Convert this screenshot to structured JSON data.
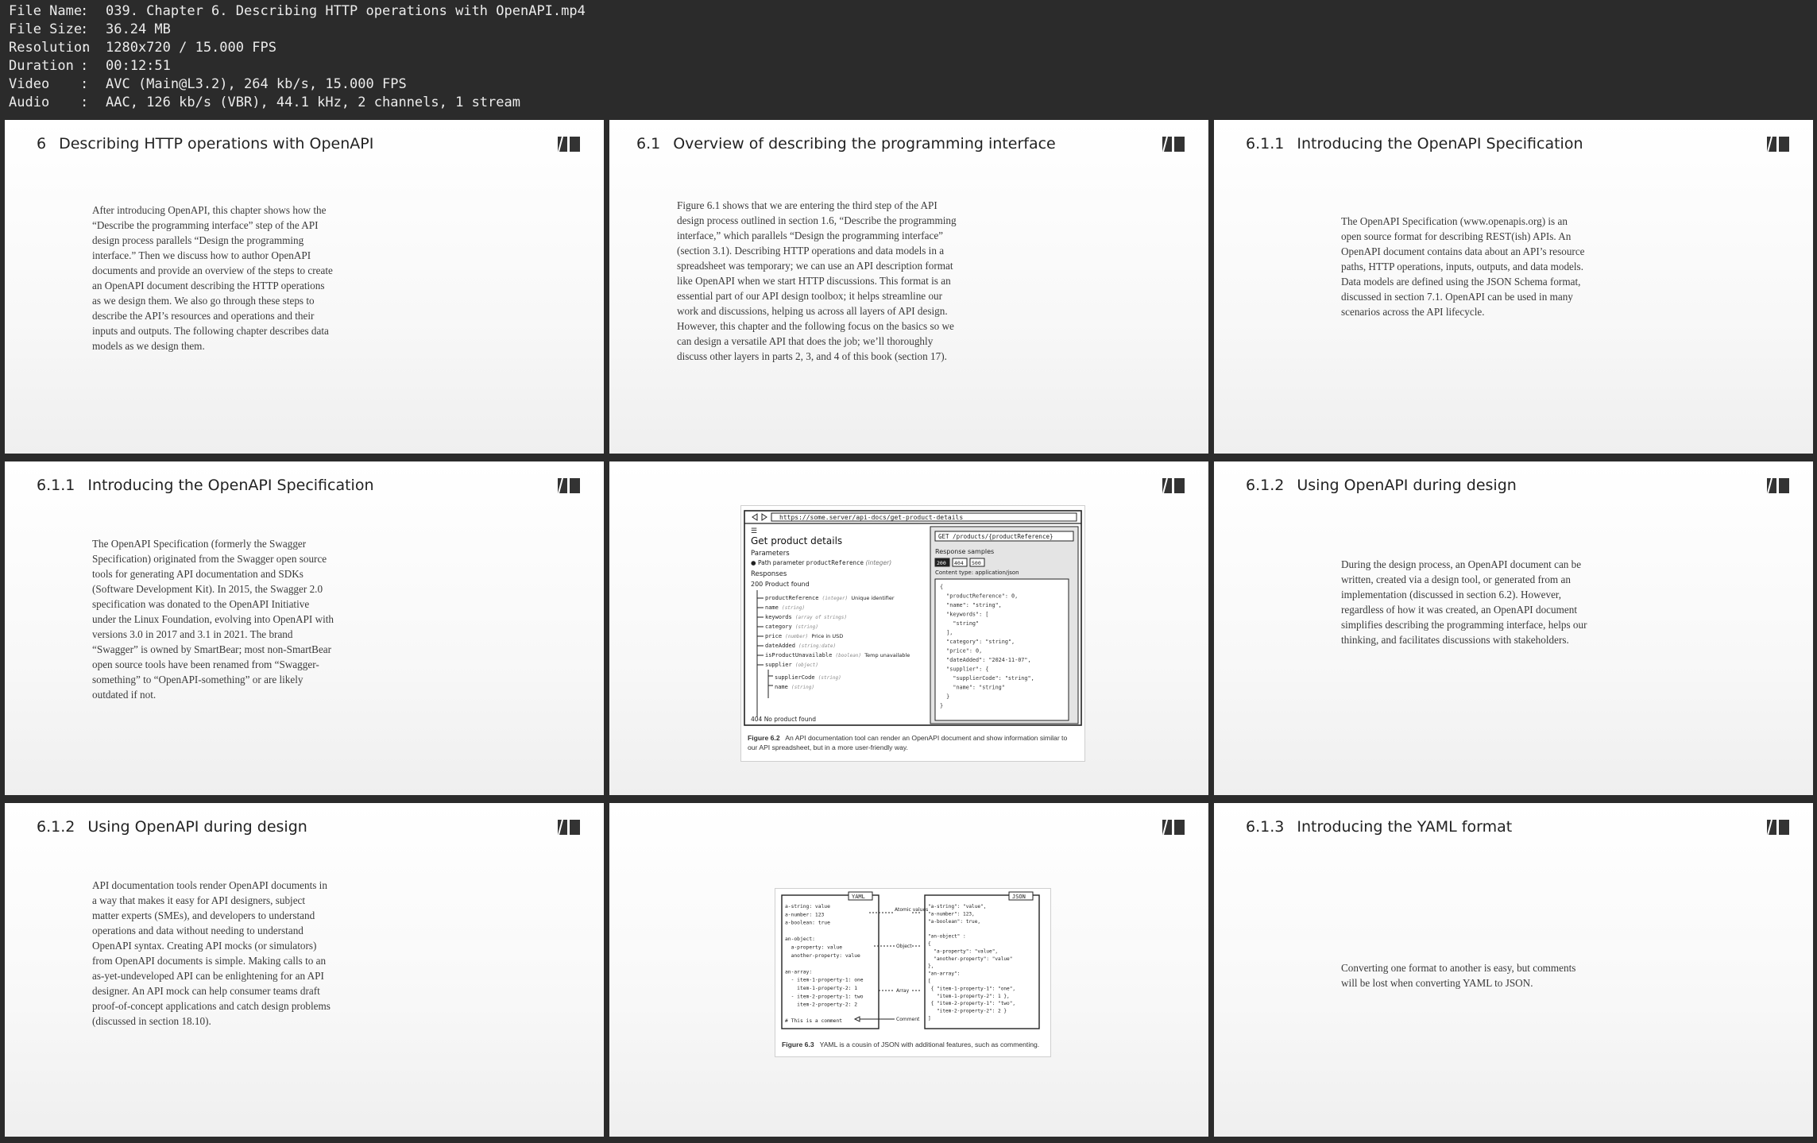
{
  "info": {
    "rows": [
      {
        "label": "File Name",
        "value": "039. Chapter 6. Describing HTTP operations with OpenAPI.mp4"
      },
      {
        "label": "File Size",
        "value": "36.24 MB"
      },
      {
        "label": "Resolution",
        "value": "1280x720 / 15.000 FPS"
      },
      {
        "label": "Duration",
        "value": "00:12:51"
      },
      {
        "label": "Video",
        "value": "AVC (Main@L3.2), 264 kb/s, 15.000 FPS"
      },
      {
        "label": "Audio",
        "value": "AAC, 126 kb/s (VBR), 44.1 kHz, 2 channels, 1 stream"
      }
    ],
    "separator": ":"
  },
  "slides": [
    {
      "num": "6",
      "title": "Describing HTTP operations with OpenAPI",
      "body": "After introducing OpenAPI, this chapter shows how the “Describe the programming interface” step of the API design process parallels “Design the programming interface.” Then we discuss how to author OpenAPI documents and provide an overview of the steps to create an OpenAPI document describing the HTTP operations as we design them. We also go through these steps to describe the API’s resources and operations and their inputs and outputs. The following chapter describes data models as we design them."
    },
    {
      "num": "6.1",
      "title": "Overview of describing the programming interface",
      "body": "Figure 6.1 shows that we are entering the third step of the API design process outlined in section 1.6, “Describe the programming interface,” which parallels “Design the programming interface” (section 3.1). Describing HTTP operations and data models in a spreadsheet was temporary; we can use an API description format like OpenAPI when we start HTTP discussions. This format is an essential part of our API design toolbox; it helps streamline our work and discussions, helping us across all layers of API design. However, this chapter and the following focus on the basics so we can design a versatile API that does the job; we’ll thoroughly discuss other layers in parts 2, 3, and 4 of this book (section 17)."
    },
    {
      "num": "6.1.1",
      "title": "Introducing the OpenAPI Specification",
      "body": "The OpenAPI Specification (www.openapis.org) is an open source format for describing REST(ish) APIs. An OpenAPI document contains data about an API’s resource paths, HTTP operations, inputs, outputs, and data models. Data models are defined using the JSON Schema format, discussed in section 7.1. OpenAPI can be used in many scenarios across the API lifecycle."
    },
    {
      "num": "6.1.1",
      "title": "Introducing the OpenAPI Specification",
      "body": "The OpenAPI Specification (formerly the Swagger Specification) originated from the Swagger open source tools for generating API documentation and SDKs (Software Development Kit). In 2015, the Swagger 2.0 specification was donated to the OpenAPI Initiative under the Linux Foundation, evolving into OpenAPI with versions 3.0 in 2017 and 3.1 in 2021. The brand “Swagger” is owned by SmartBear; most non-SmartBear open source tools have been renamed from “Swagger-something” to “OpenAPI-something” or are likely outdated if not."
    },
    {
      "num": "",
      "title": "",
      "body": ""
    },
    {
      "num": "6.1.2",
      "title": "Using OpenAPI during design",
      "body": "During the design process, an OpenAPI document can be written, created via a design tool, or generated from an implementation (discussed in section 6.2). However, regardless of how it was created, an OpenAPI document simplifies describing the programming interface, helps our thinking, and facilitates discussions with stakeholders."
    },
    {
      "num": "6.1.2",
      "title": "Using OpenAPI during design",
      "body": "API documentation tools render OpenAPI documents in a way that makes it easy for API designers, subject matter experts (SMEs), and developers to understand operations and data without needing to understand OpenAPI syntax. Creating API mocks (or simulators) from OpenAPI documents is simple. Making calls to an as-yet-undeveloped API can be enlightening for an API designer. An API mock can help consumer teams draft proof-of-concept applications and catch design problems (discussed in section 18.10)."
    },
    {
      "num": "",
      "title": "",
      "body": ""
    },
    {
      "num": "6.1.3",
      "title": "Introducing the YAML format",
      "body": "Converting one format to another is easy, but comments will be lost when converting YAML to JSON."
    }
  ],
  "figure62": {
    "url": "https://some.server/api-docs/get-product-details",
    "heading": "Get product details",
    "parameters_label": "Parameters",
    "path_param_label": "Path parameter",
    "path_param_name": "productReference",
    "path_param_type": "(integer)",
    "responses_label": "Responses",
    "response_200": "200 Product found",
    "fields": [
      {
        "name": "productReference",
        "type": "(integer)",
        "note": "Unique identifier"
      },
      {
        "name": "name",
        "type": "(string)",
        "note": ""
      },
      {
        "name": "keywords",
        "type": "(array of strings)",
        "note": ""
      },
      {
        "name": "category",
        "type": "(string)",
        "note": ""
      },
      {
        "name": "price",
        "type": "(number)",
        "note": "Price in USD"
      },
      {
        "name": "dateAdded",
        "type": "(string:date)",
        "note": ""
      },
      {
        "name": "isProductUnavailable",
        "type": "(boolean)",
        "note": "Temp unavailable"
      },
      {
        "name": "supplier",
        "type": "(object)",
        "note": ""
      },
      {
        "name": "supplierCode",
        "type": "(string)",
        "note": ""
      },
      {
        "name": "name",
        "type": "(string)",
        "note": ""
      }
    ],
    "response_404": "404 No product found",
    "endpoint": "GET /products/{productReference}",
    "samples_label": "Response samples",
    "status_codes": [
      "200",
      "404",
      "500"
    ],
    "content_type": "Content type: application/json",
    "json_lines": [
      "{",
      "  \"productReference\": 0,",
      "  \"name\": \"string\",",
      "  \"keywords\": [",
      "    \"string\"",
      "  ],",
      "  \"category\": \"string\",",
      "  \"price\": 0,",
      "  \"dateAdded\": \"2024-11-07\",",
      "  \"supplier\": {",
      "    \"supplierCode\": \"string\",",
      "    \"name\": \"string\"",
      "  }",
      "}"
    ],
    "caption_label": "Figure 6.2",
    "caption_text": "An API documentation tool can render an OpenAPI document and show information similar to our API spreadsheet, but in a more user-friendly way."
  },
  "figure63": {
    "yaml_tag": "YAML",
    "json_tag": "JSON",
    "yaml_lines": [
      "a-string: value",
      "a-number: 123",
      "a-boolean: true",
      "",
      "an-object:",
      "  a-property: value",
      "  another-property: value",
      "",
      "an-array:",
      "  - item-1-property-1: one",
      "    item-1-property-2: 1",
      "  - item-2-property-1: two",
      "    item-2-property-2: 2",
      "",
      "# This is a comment"
    ],
    "json_lines": [
      "\"a-string\": \"value\",",
      "\"a-number\": 123,",
      "\"a-boolean\": true,",
      "",
      "\"an-object\" :",
      "{",
      "  \"a-property\": \"value\",",
      "  \"another-property\": \"value\"",
      "},",
      "\"an-array\":",
      "[",
      " { \"item-1-property-1\": \"one\",",
      "   \"item-1-property-2\": 1 },",
      " { \"item-2-property-1\": \"two\",",
      "   \"item-2-property-2\": 2 }",
      "]"
    ],
    "labels": [
      "Atomic values",
      "Object",
      "Array",
      "Comment"
    ],
    "caption_label": "Figure 6.3",
    "caption_text": "YAML is a cousin of JSON with additional features, such as commenting."
  }
}
